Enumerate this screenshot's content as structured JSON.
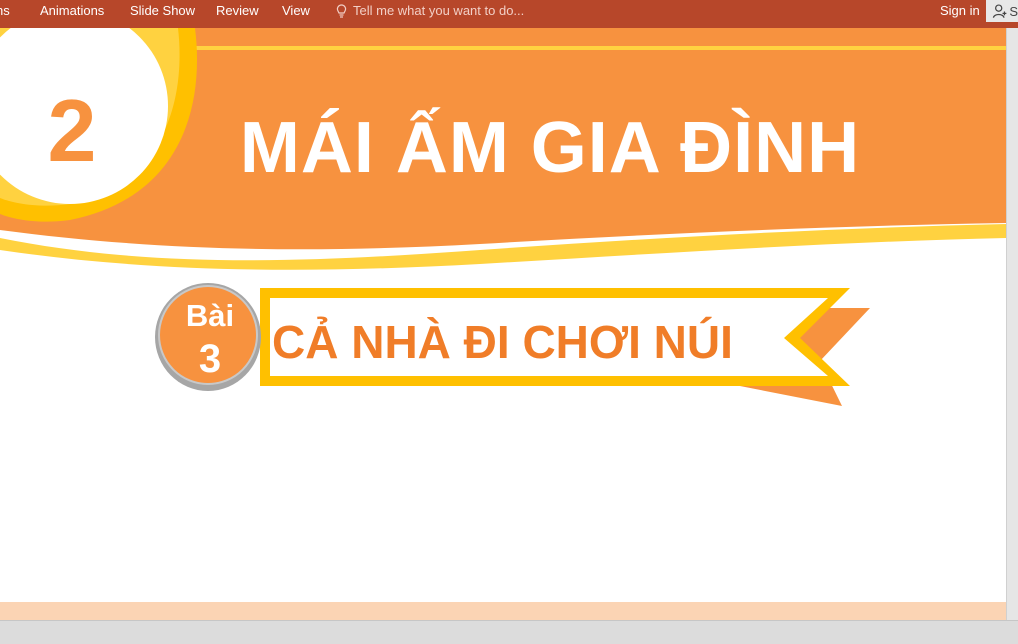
{
  "ribbon": {
    "tabs": [
      "ns",
      "Animations",
      "Slide Show",
      "Review",
      "View"
    ],
    "tell_me": "Tell me what you want to do...",
    "sign_in": "Sign in",
    "share_label": "S"
  },
  "slide": {
    "chapter_number": "2",
    "chapter_title": "MÁI ẤM GIA ĐÌNH",
    "lesson_word": "Bài",
    "lesson_number": "3",
    "lesson_title": "CẢ NHÀ ĐI CHƠI NÚI"
  },
  "colors": {
    "ribbon": "#b7472a",
    "banner_orange": "#f7923f",
    "banner_yellow": "#ffc000",
    "title_orange": "#f07d28",
    "light_peach": "#fbd4b4"
  }
}
